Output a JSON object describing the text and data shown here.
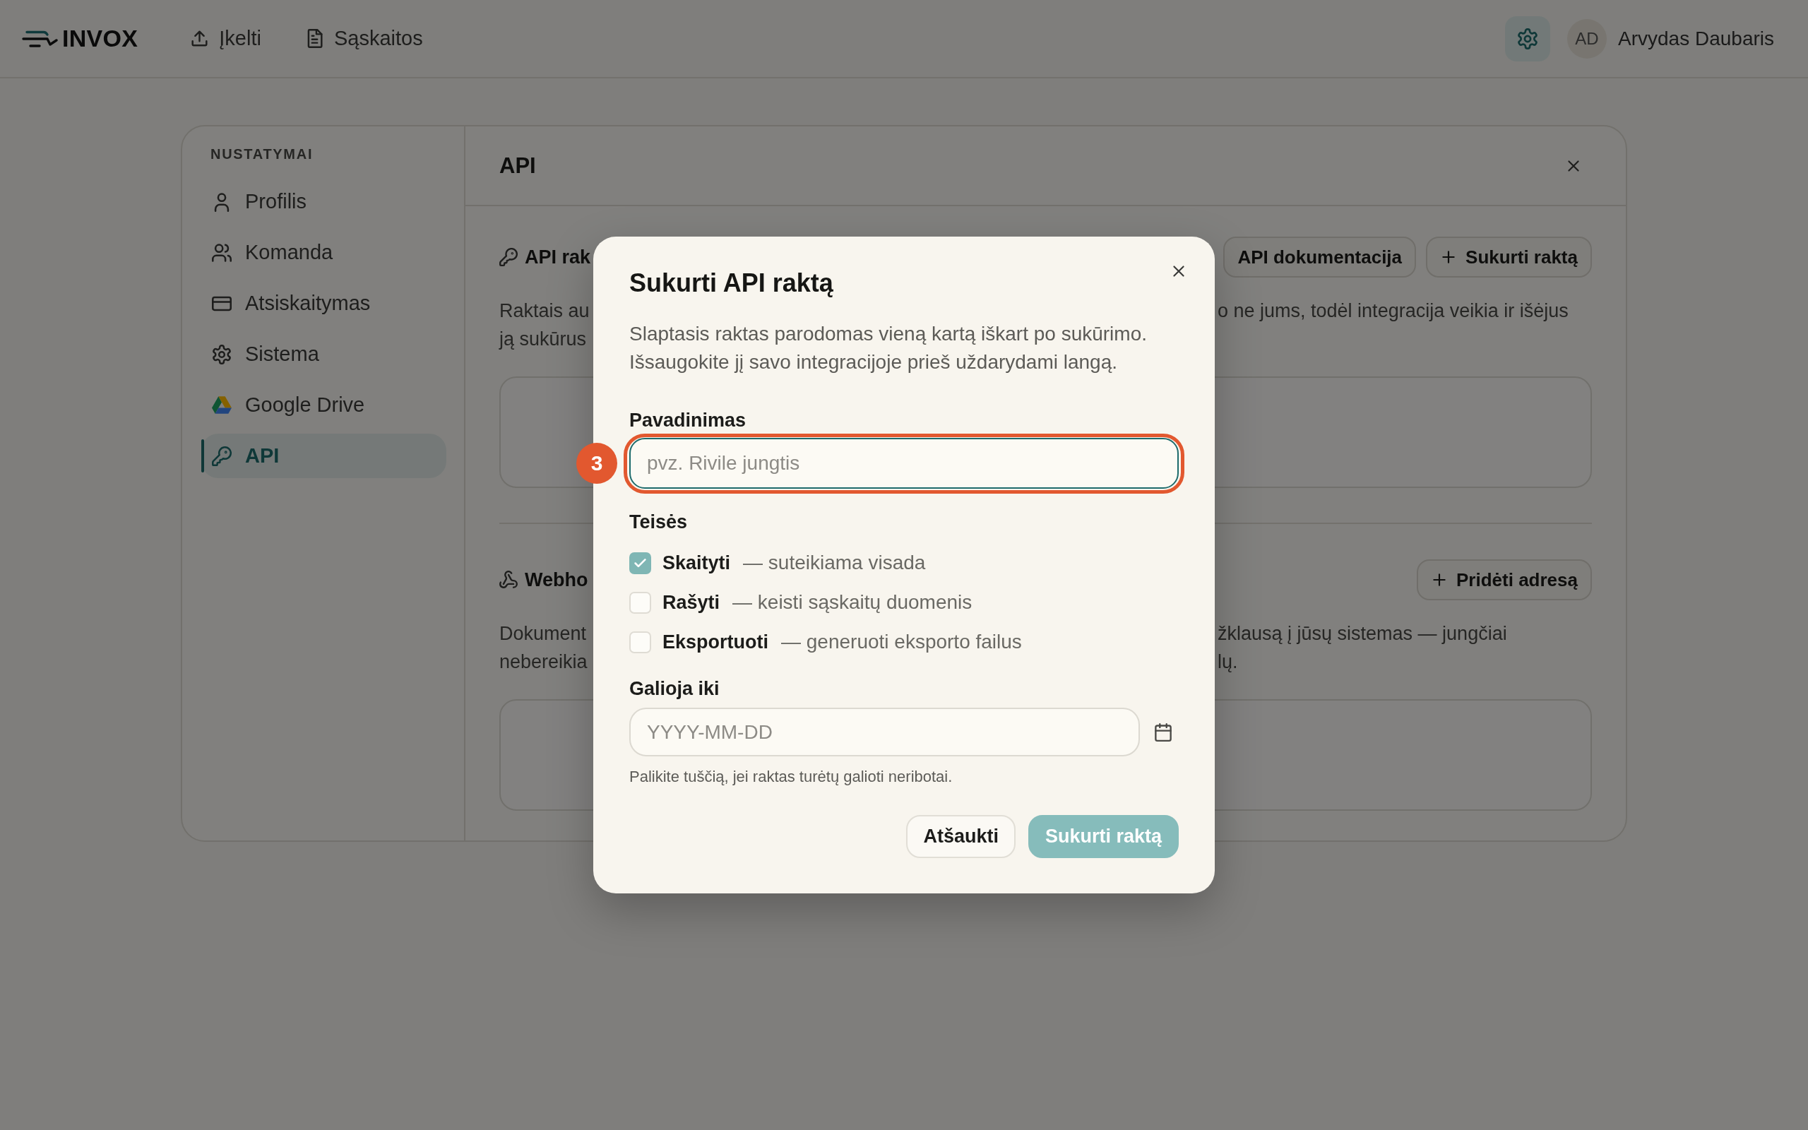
{
  "topbar": {
    "logo": "INVOX",
    "nav": [
      {
        "label": "Įkelti"
      },
      {
        "label": "Sąskaitos"
      }
    ],
    "settings_button": {
      "selected": true
    },
    "user": {
      "initials": "AD",
      "name": "Arvydas Daubaris"
    }
  },
  "sidebar": {
    "heading": "NUSTATYMAI",
    "items": [
      {
        "label": "Profilis",
        "selected": false
      },
      {
        "label": "Komanda",
        "selected": false
      },
      {
        "label": "Atsiskaitymas",
        "selected": false
      },
      {
        "label": "Sistema",
        "selected": false
      },
      {
        "label": "Google Drive",
        "selected": false
      },
      {
        "label": "API",
        "selected": true
      }
    ]
  },
  "panel": {
    "title": "API",
    "sections": [
      {
        "title": "API rak",
        "description": {
          "left": [
            "Raktais au",
            "ją sukūrus"
          ],
          "right": [
            "o ne jums, todėl integracija veikia ir išėjus"
          ]
        },
        "buttons": [
          {
            "label": "API dokumentacija",
            "kind": "plain"
          },
          {
            "label": "Sukurti raktą",
            "kind": "add"
          }
        ]
      },
      {
        "title": "Webho",
        "description": {
          "left": [
            "Dokument",
            "nebereikia"
          ],
          "right": [
            "žklausą į jūsų sistemas — jungčiai",
            "lų."
          ]
        },
        "buttons": [
          {
            "label": "Pridėti adresą",
            "kind": "add"
          }
        ]
      }
    ]
  },
  "dialog": {
    "title": "Sukurti API raktą",
    "description": "Slaptasis raktas parodomas vieną kartą iškart po sukūrimo. Išsaugokite jį savo integracijoje prieš uždarydami langą.",
    "name_field": {
      "label": "Pavadinimas",
      "placeholder": "pvz. Rivile jungtis",
      "focused": true,
      "callout": "3"
    },
    "permissions": {
      "label": "Teisės",
      "options": [
        {
          "label": "Skaityti",
          "note": "— suteikiama visada",
          "checked": true
        },
        {
          "label": "Rašyti",
          "note": "— keisti sąskaitų duomenis",
          "checked": false
        },
        {
          "label": "Eksportuoti",
          "note": "— generuoti eksporto failus",
          "checked": false
        }
      ]
    },
    "expiry_field": {
      "label": "Galioja iki",
      "placeholder": "YYYY-MM-DD",
      "hint": "Palikite tuščią, jei raktas turėtų galioti neribotai."
    },
    "buttons": [
      {
        "label": "Atšaukti",
        "kind": "secondary",
        "disabled": false
      },
      {
        "label": "Sukurti raktą",
        "kind": "primary",
        "disabled": true
      }
    ]
  }
}
